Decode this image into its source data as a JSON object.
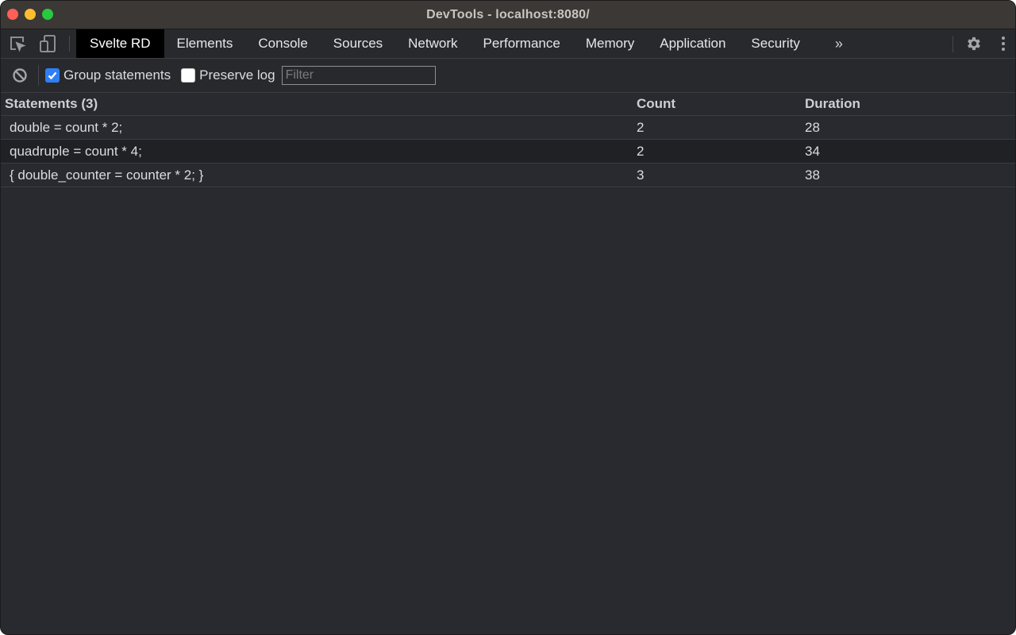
{
  "window": {
    "title": "DevTools - localhost:8080/",
    "traffic_lights": [
      "close",
      "minimize",
      "maximize"
    ]
  },
  "tabbar": {
    "left_icons": [
      "inspect-element-icon",
      "device-toolbar-icon"
    ],
    "tabs": [
      {
        "label": "Svelte RD",
        "active": true
      },
      {
        "label": "Elements",
        "active": false
      },
      {
        "label": "Console",
        "active": false
      },
      {
        "label": "Sources",
        "active": false
      },
      {
        "label": "Network",
        "active": false
      },
      {
        "label": "Performance",
        "active": false
      },
      {
        "label": "Memory",
        "active": false
      },
      {
        "label": "Application",
        "active": false
      },
      {
        "label": "Security",
        "active": false
      }
    ],
    "more_label": "»",
    "right_icons": [
      "gear-icon",
      "kebab-menu-icon"
    ]
  },
  "toolbar": {
    "clear_icon": "clear-block-icon",
    "group_statements": {
      "label": "Group statements",
      "checked": true
    },
    "preserve_log": {
      "label": "Preserve log",
      "checked": false
    },
    "filter": {
      "value": "",
      "placeholder": "Filter"
    }
  },
  "table": {
    "columns": [
      "Statements (3)",
      "Count",
      "Duration"
    ],
    "rows": [
      {
        "statement": "double = count * 2;",
        "count": "2",
        "duration": "28"
      },
      {
        "statement": "quadruple = count * 4;",
        "count": "2",
        "duration": "34"
      },
      {
        "statement": "{ double_counter = counter * 2; }",
        "count": "3",
        "duration": "38"
      }
    ]
  },
  "colors": {
    "accent_checkbox": "#2f7ef6",
    "background": "#292a2f",
    "active_tab": "#000000"
  }
}
